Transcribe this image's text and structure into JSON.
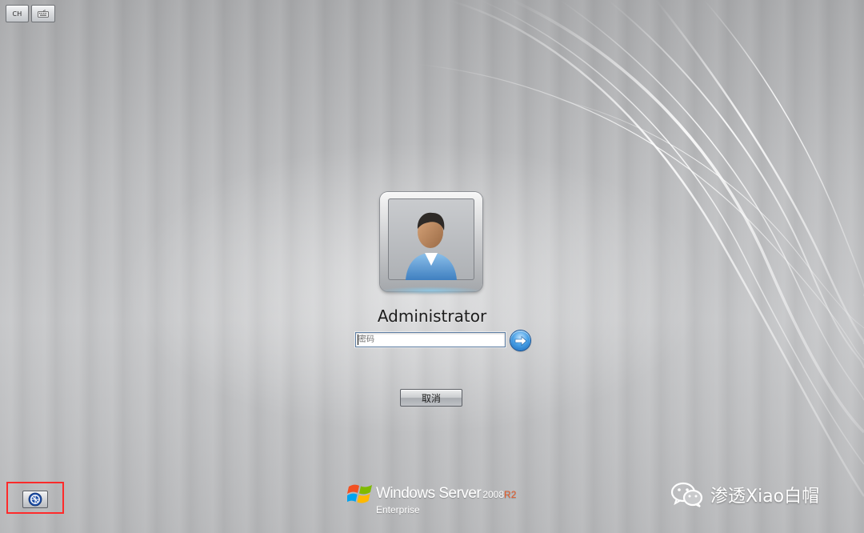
{
  "top_bar": {
    "language_label": "CH",
    "keyboard_icon": "keyboard-icon"
  },
  "login": {
    "username": "Administrator",
    "password_placeholder": "密码",
    "submit_icon": "arrow-right-icon",
    "cancel_label": "取消"
  },
  "bottom": {
    "ease_of_access_icon": "ease-of-access-icon"
  },
  "branding": {
    "product_name": "Windows Server",
    "version": "2008",
    "release": "R2",
    "edition": "Enterprise",
    "logo_icon": "windows-flag-icon"
  },
  "watermark": {
    "text": "渗透Xiao白帽",
    "icon": "wechat-icon"
  },
  "colors": {
    "highlight_box": "#ff2a2a",
    "submit_button": "#2f86d6",
    "release_accent": "#e45b2a"
  }
}
